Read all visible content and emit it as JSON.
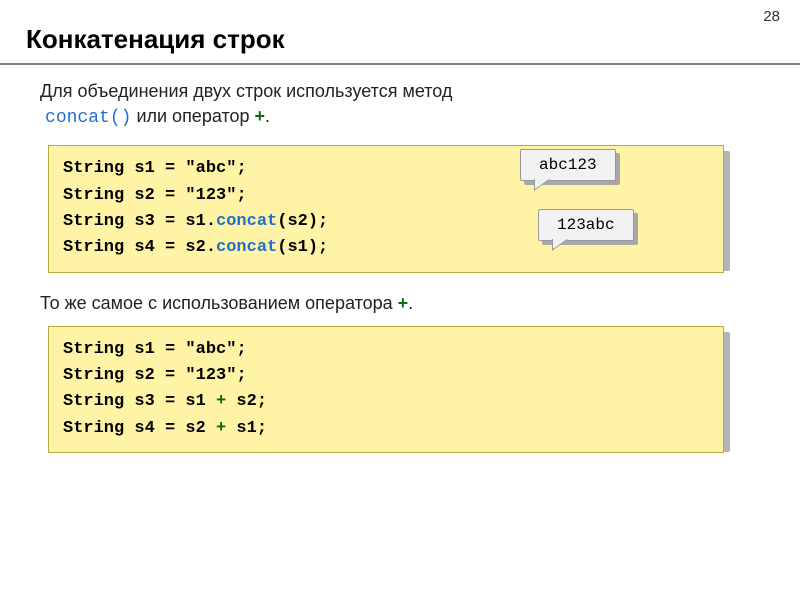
{
  "page_number": "28",
  "title": "Конкатенация строк",
  "intro": {
    "line1": "Для объединения двух строк используется метод",
    "method": "concat()",
    "after_method": " или оператор ",
    "plus": "+",
    "period": "."
  },
  "code1": {
    "l1a": "String s1 = ",
    "l1b": "\"abc\"",
    "l1c": ";",
    "l2a": "String s2 = ",
    "l2b": "\"123\"",
    "l2c": ";",
    "l3a": "String s3 = s1.",
    "l3b": "concat",
    "l3c": "(s2);",
    "l4a": "String s4 = s2.",
    "l4b": "concat",
    "l4c": "(s1);"
  },
  "callouts": {
    "out1": "abc123",
    "out2": "123abc"
  },
  "mid_text": {
    "part1": "То же самое с использованием оператора ",
    "plus": "+",
    "period": "."
  },
  "code2": {
    "l1a": "String s1 = ",
    "l1b": "\"abc\"",
    "l1c": ";",
    "l2a": "String s2 = ",
    "l2b": "\"123\"",
    "l2c": ";",
    "l3a": "String s3 = s1 ",
    "l3b": "+",
    "l3c": " s2;",
    "l4a": "String s4 = s2 ",
    "l4b": "+",
    "l4c": " s1;"
  }
}
